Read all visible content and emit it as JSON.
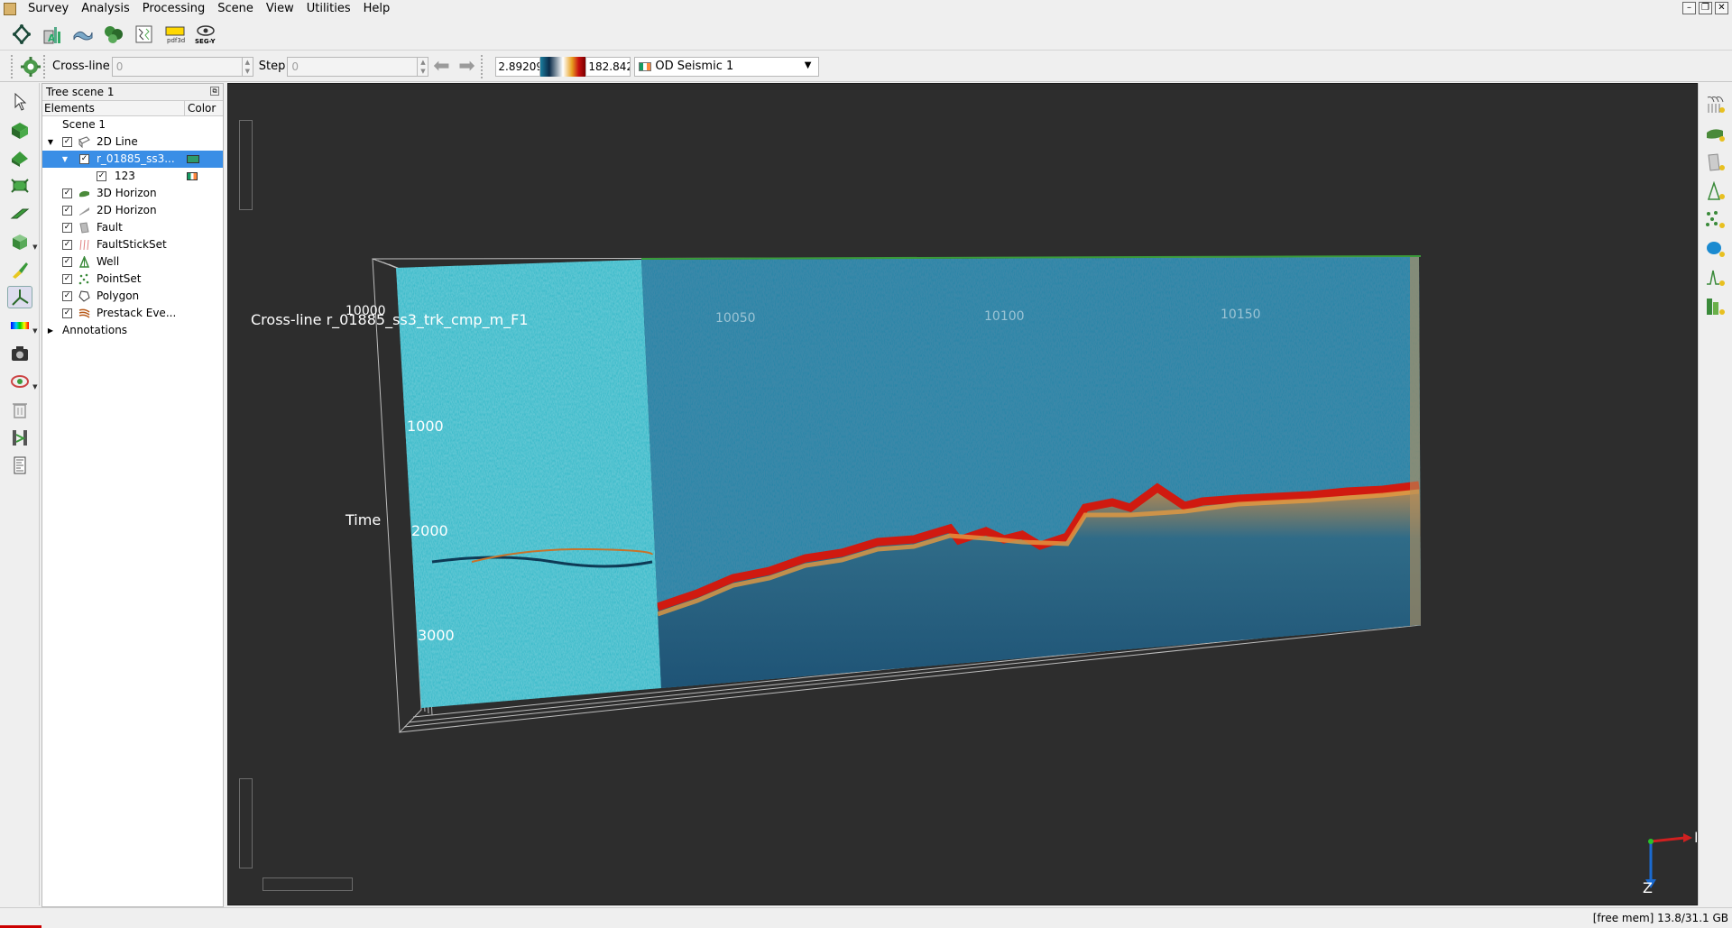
{
  "menu": {
    "items": [
      "Survey",
      "Analysis",
      "Processing",
      "Scene",
      "View",
      "Utilities",
      "Help"
    ]
  },
  "toolbar1": {
    "icons": [
      "survey-icon",
      "attribute-icon",
      "horizon-tools-icon",
      "volume-icon",
      "well-log-icon",
      "pdf-icon",
      "segy-icon"
    ],
    "pdf_label": "pdf3d",
    "segy_label": "SEG-Y"
  },
  "toolbar2": {
    "crossline_label": "Cross-line",
    "crossline_value": "0",
    "step_label": "Step",
    "step_value": "0",
    "colorbar_min": "2.89209",
    "colorbar_max": "182.842",
    "attribute": "OD Seismic 1"
  },
  "tree": {
    "title": "Tree scene 1",
    "col_elements": "Elements",
    "col_color": "Color",
    "scene": "Scene 1",
    "rows": [
      {
        "label": "2D Line",
        "checked": "✓"
      },
      {
        "label": "r_01885_ss3...",
        "checked": "✓"
      },
      {
        "label": "123",
        "checked": "✓"
      },
      {
        "label": "3D Horizon",
        "checked": "✓"
      },
      {
        "label": "2D Horizon",
        "checked": "✓"
      },
      {
        "label": "Fault",
        "checked": "✓"
      },
      {
        "label": "FaultStickSet",
        "checked": "✓"
      },
      {
        "label": "Well",
        "checked": "✓"
      },
      {
        "label": "PointSet",
        "checked": "✓"
      },
      {
        "label": "Polygon",
        "checked": "✓"
      },
      {
        "label": "Prestack Eve...",
        "checked": "✓"
      }
    ],
    "annotations": "Annotations"
  },
  "scene": {
    "line_title": "Cross-line r_01885_ss3_trk_cmp_m_F1",
    "top_ticks": [
      "10000",
      "10050",
      "10100",
      "10150"
    ],
    "time_label": "Time",
    "time_ticks": [
      "1000",
      "2000",
      "3000"
    ],
    "compass_n": "N",
    "compass_z": "Z"
  },
  "status": {
    "memory": "[free mem] 13.8/31.1 GB"
  },
  "colors": {
    "viewport_bg": "#2d2d2d",
    "seismic_light": "#3fbccb",
    "seismic_dark": "#155a7e",
    "horizon_red": "#d01a10",
    "selection": "#3a8ee6"
  }
}
